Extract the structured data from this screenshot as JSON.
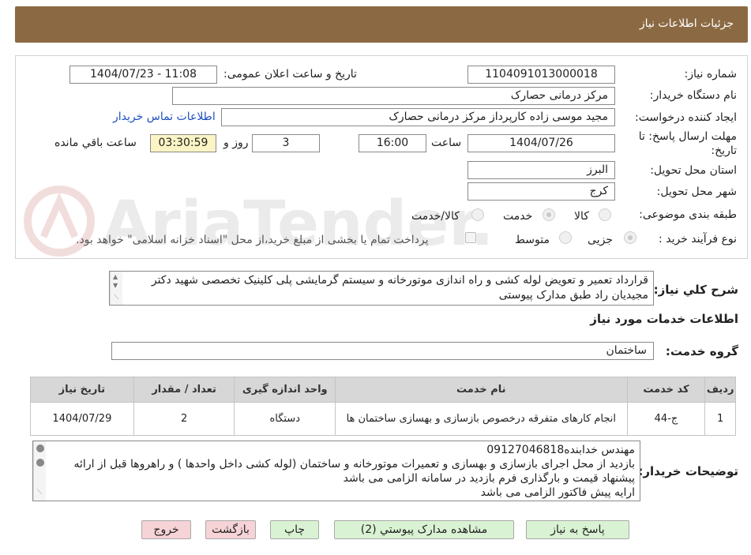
{
  "header": {
    "title": "جزئیات اطلاعات نیاز"
  },
  "form": {
    "need_number_label": "شماره نیاز:",
    "need_number": "1104091013000018",
    "announce_label": "تاریخ و ساعت اعلان عمومی:",
    "announce_value": "1404/07/23 - 11:08",
    "buyer_org_label": "نام دستگاه خریدار:",
    "buyer_org": "مرکز درمانی حصارک",
    "creator_label": "ایجاد کننده درخواست:",
    "creator": "مجید  موسی زاده کارپرداز مرکز درمانی حصارک",
    "contact_link": "اطلاعات تماس خریدار",
    "deadline_label_1": "مهلت ارسال پاسخ: تا",
    "deadline_label_2": "تاریخ:",
    "deadline_date": "1404/07/26",
    "time_label": "ساعت",
    "deadline_time": "16:00",
    "days_value": "3",
    "days_label": "روز و",
    "remaining_time": "03:30:59",
    "remaining_label": "ساعت باقي مانده",
    "province_label": "استان محل تحویل:",
    "province": "البرز",
    "city_label": "شهر محل تحویل:",
    "city": "کرج",
    "category_label": "طبقه بندی موضوعی:",
    "category_options": [
      "کالا",
      "خدمت",
      "کالا/خدمت"
    ],
    "category_selected": "خدمت",
    "process_label": "نوع فرآیند خرید :",
    "process_options": [
      "جزیی",
      "متوسط"
    ],
    "process_selected": "جزیی",
    "payment_note": "پرداخت تمام یا بخشی از مبلغ خرید،از محل \"اسناد خزانه اسلامی\" خواهد بود."
  },
  "description": {
    "label": "شرح کلي نياز:",
    "text": "قرارداد تعمیر و تعویض لوله کشی و راه اندازی موتورخانه و سیستم گرمایشی پلی کلینیک تخصصی شهید دکتر مجیدیان راد  طبق مدارک پیوستی"
  },
  "services": {
    "section_title": "اطلاعات خدمات مورد نياز",
    "group_label": "گروه خدمت:",
    "group_value": "ساختمان",
    "columns": [
      "رديف",
      "کد خدمت",
      "نام خدمت",
      "واحد اندازه گیری",
      "تعداد / مقدار",
      "تاریخ نیاز"
    ],
    "rows": [
      {
        "index": "1",
        "code": "ج-44",
        "name": "انجام کارهای متفرقه درخصوص بازسازی و بهسازی ساختمان ها",
        "unit": "دستگاه",
        "qty": "2",
        "date": "1404/07/29"
      }
    ]
  },
  "buyer_notes": {
    "label": "توضیحات خریدار:",
    "text": "مهندس خدابنده09127046818\nبازدید از محل اجرای بازسازی و بهسازی و تعمیرات موتورخانه و ساختمان (لوله کشی داخل واحدها ) و راهروها قبل از ارائه پیشنهاد قیمت و بارگذاری فرم بازدید در سامانه الزامی می باشد\nارایه پیش فاکتور الزامی می باشد"
  },
  "buttons": {
    "reply": "پاسخ به نياز",
    "attachments": "مشاهده مدارک پيوستي (2)",
    "print": "چاپ",
    "back": "بازگشت",
    "exit": "خروج"
  },
  "colors": {
    "header_bg": "#8b6a43",
    "timer_bg": "#fbf4c5",
    "button_green": "#d9f2d3",
    "button_red": "#f6d3d6",
    "link": "#1f4fbf"
  }
}
